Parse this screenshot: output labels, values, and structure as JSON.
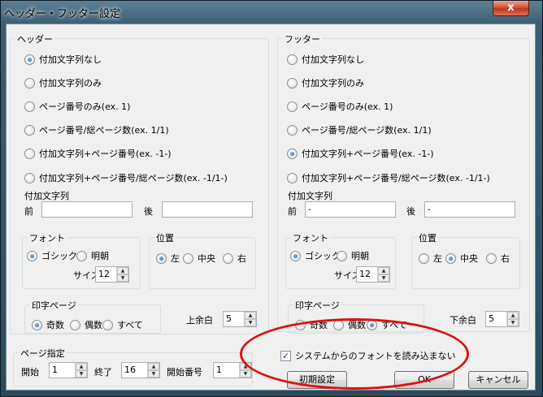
{
  "window": {
    "title": "ヘッダー・フッター設定"
  },
  "header": {
    "group_title": "ヘッダー",
    "options": [
      {
        "label": "付加文字列なし",
        "selected": true
      },
      {
        "label": "付加文字列のみ",
        "selected": false
      },
      {
        "label": "ページ番号のみ(ex. 1)",
        "selected": false
      },
      {
        "label": "ページ番号/総ページ数(ex. 1/1)",
        "selected": false
      },
      {
        "label": "付加文字列+ページ番号(ex. -1-)",
        "selected": false
      },
      {
        "label": "付加文字列+ページ番号/総ページ数(ex. -1/1-)",
        "selected": false
      }
    ],
    "text_label": "付加文字列",
    "before_label": "前",
    "before_value": "",
    "after_label": "後",
    "after_value": "",
    "font": {
      "group_title": "フォント",
      "gothic": "ゴシック",
      "mincho": "明朝",
      "selected": "gothic",
      "size_label": "サイズ",
      "size": "12"
    },
    "position": {
      "group_title": "位置",
      "left": "左",
      "center": "中央",
      "right": "右",
      "selected": "left"
    },
    "print_pages": {
      "group_title": "印字ページ",
      "odd": "奇数",
      "even": "偶数",
      "all": "すべて",
      "selected": "odd"
    },
    "margin_label": "上余白",
    "margin": "5"
  },
  "footer": {
    "group_title": "フッター",
    "options": [
      {
        "label": "付加文字列なし",
        "selected": false
      },
      {
        "label": "付加文字列のみ",
        "selected": false
      },
      {
        "label": "ページ番号のみ(ex. 1)",
        "selected": false
      },
      {
        "label": "ページ番号/総ページ数(ex. 1/1)",
        "selected": false
      },
      {
        "label": "付加文字列+ページ番号(ex. -1-)",
        "selected": true
      },
      {
        "label": "付加文字列+ページ番号/総ページ数(ex. -1/1-)",
        "selected": false
      }
    ],
    "text_label": "付加文字列",
    "before_label": "前",
    "before_value": "-",
    "after_label": "後",
    "after_value": "-",
    "font": {
      "group_title": "フォント",
      "gothic": "ゴシック",
      "mincho": "明朝",
      "selected": "gothic",
      "size_label": "サイズ",
      "size": "12"
    },
    "position": {
      "group_title": "位置",
      "left": "左",
      "center": "中央",
      "right": "右",
      "selected": "center"
    },
    "print_pages": {
      "group_title": "印字ページ",
      "odd": "奇数",
      "even": "偶数",
      "all": "すべて",
      "selected": "all"
    },
    "margin_label": "下余白",
    "margin": "5"
  },
  "page_range": {
    "group_title": "ページ指定",
    "start_label": "開始",
    "start": "1",
    "end_label": "終了",
    "end": "16",
    "start_number_label": "開始番号",
    "start_number": "1"
  },
  "system_font": {
    "label": "システムからのフォントを読み込まない",
    "checked": true
  },
  "buttons": {
    "reset": "初期設定",
    "ok": "OK",
    "cancel": "キャンセル",
    "close": "x"
  },
  "colors": {
    "highlight": "#e01010",
    "radio_selected": "#1a63b4"
  }
}
